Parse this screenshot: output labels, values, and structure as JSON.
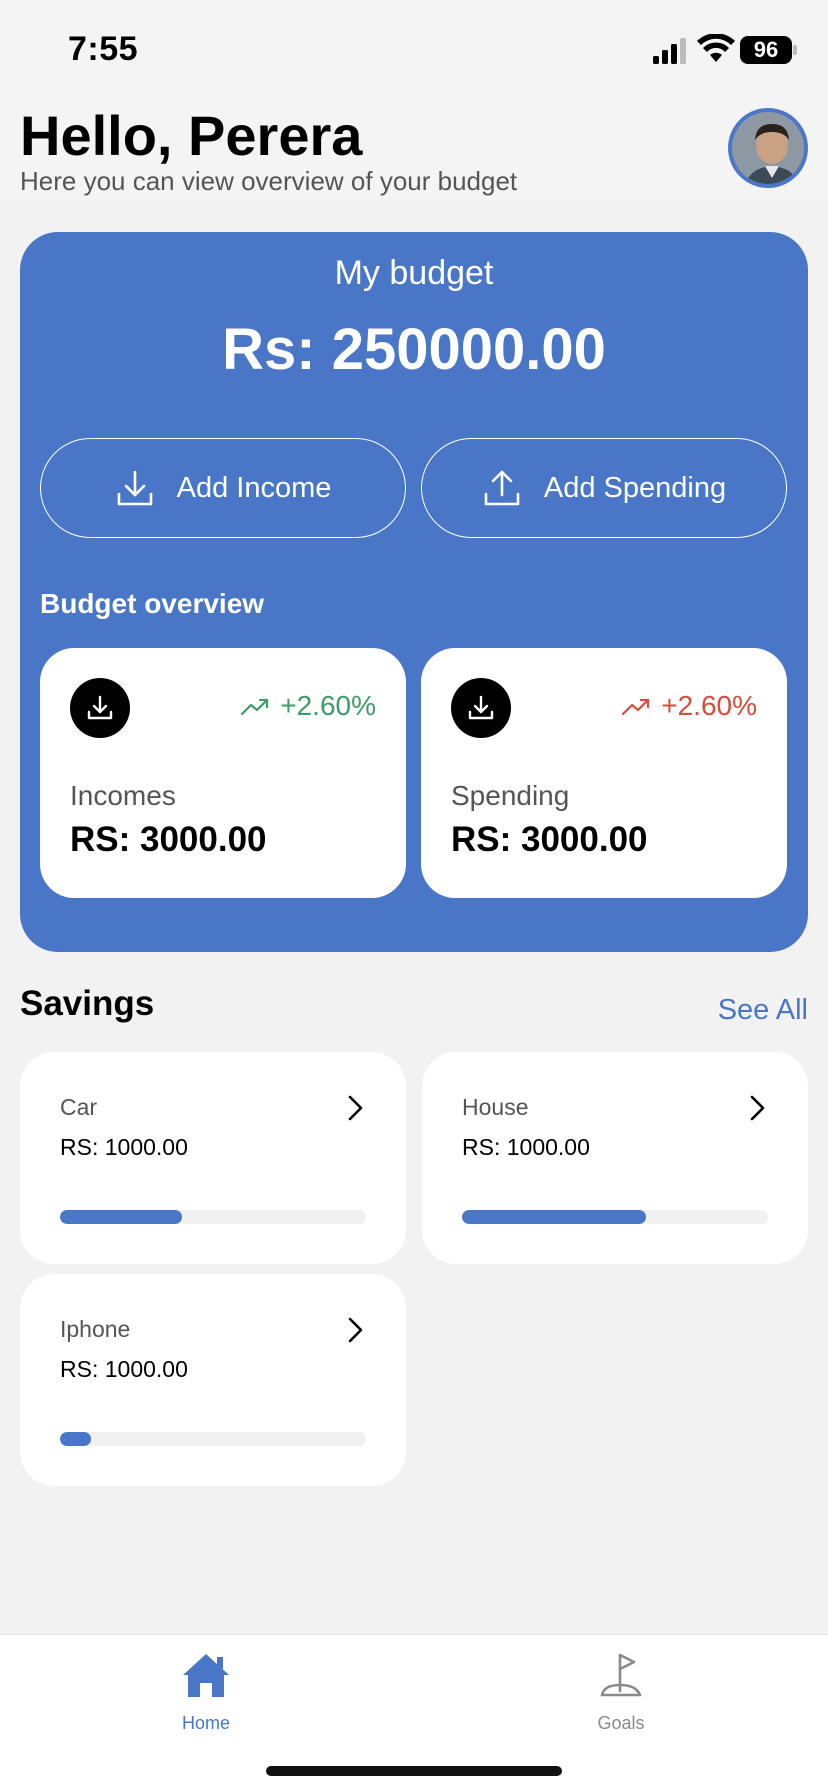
{
  "status": {
    "time": "7:55",
    "battery": "96"
  },
  "header": {
    "greeting": "Hello, Perera",
    "subtitle": "Here you can view overview of your budget"
  },
  "budget": {
    "title": "My budget",
    "amount": "Rs: 250000.00",
    "add_income_label": "Add Income",
    "add_spending_label": "Add Spending",
    "overview_label": "Budget overview",
    "overview": [
      {
        "name": "Incomes",
        "value": "RS: 3000.00",
        "trend": "+2.60%",
        "trend_color": "#3e9b6a"
      },
      {
        "name": "Spending",
        "value": "RS: 3000.00",
        "trend": "+2.60%",
        "trend_color": "#d84c3a"
      }
    ]
  },
  "savings": {
    "title": "Savings",
    "see_all": "See All",
    "items": [
      {
        "name": "Car",
        "value": "RS: 1000.00",
        "progress": 0.4
      },
      {
        "name": "House",
        "value": "RS: 1000.00",
        "progress": 0.6
      },
      {
        "name": "Iphone",
        "value": "RS: 1000.00",
        "progress": 0.1
      }
    ]
  },
  "tabbar": {
    "items": [
      {
        "label": "Home",
        "icon": "home-icon",
        "active": true
      },
      {
        "label": "Goals",
        "icon": "flag-icon",
        "active": false
      }
    ]
  },
  "colors": {
    "accent": "#4a76c8",
    "positive": "#3e9b6a",
    "negative": "#d84c3a"
  }
}
